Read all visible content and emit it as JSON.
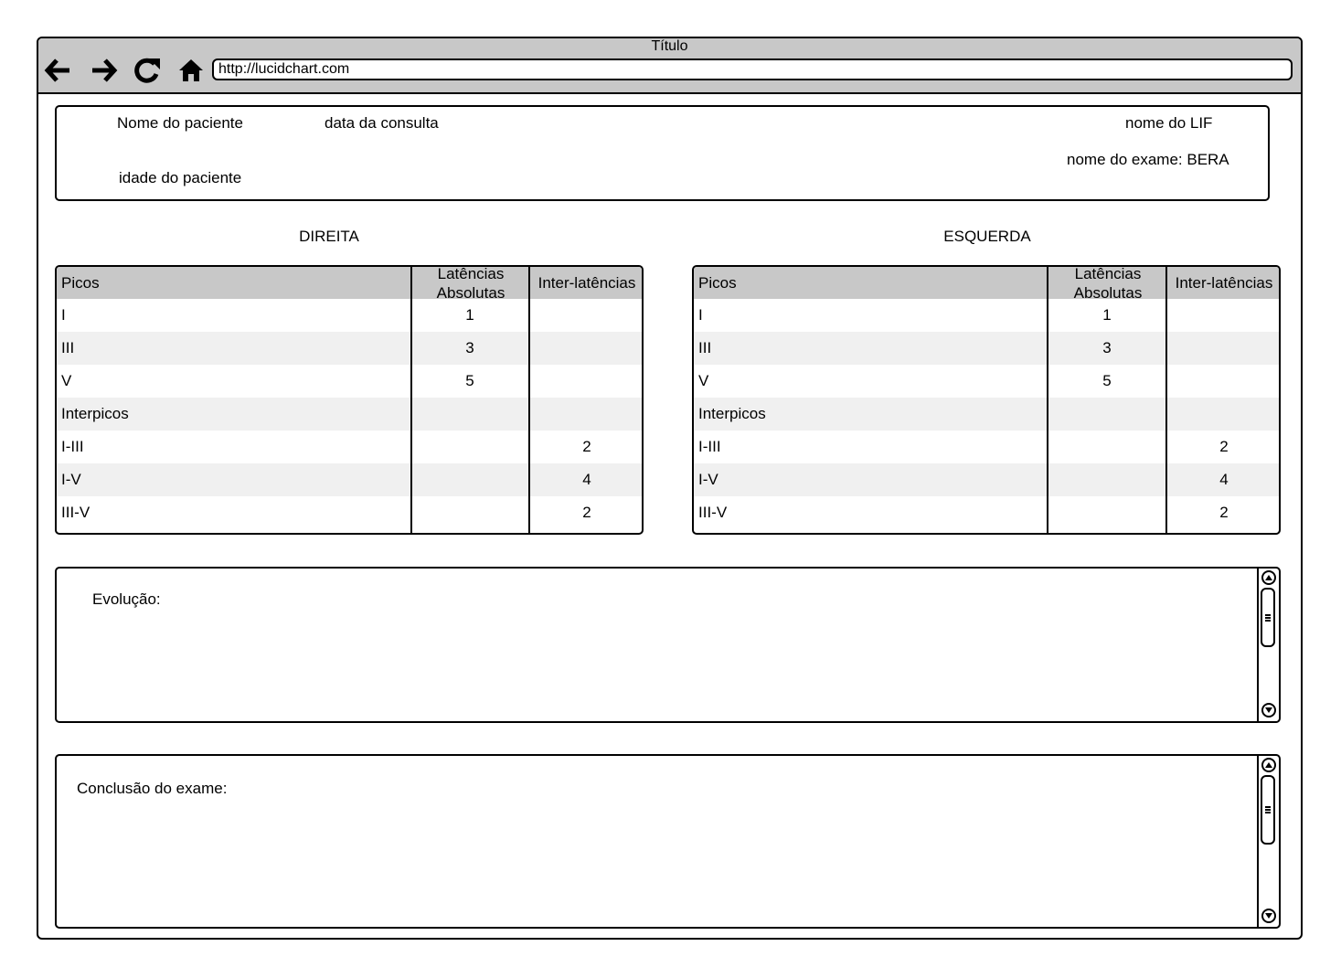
{
  "window": {
    "title": "Título",
    "url": "http://lucidchart.com",
    "nav_icons": [
      "back-arrow-icon",
      "forward-arrow-icon",
      "reload-icon",
      "home-icon"
    ]
  },
  "header": {
    "patient_name": "Nome do paciente",
    "consult_date": "data da consulta",
    "patient_age": "idade do paciente",
    "lif_name": "nome do LIF",
    "exam_name": "nome do exame: BERA"
  },
  "right_table": {
    "title": "DIREITA",
    "columns": [
      "Picos",
      "Latências Absolutas",
      "Inter-latências"
    ],
    "rows": [
      {
        "pico": "I",
        "abs": "1",
        "inter": ""
      },
      {
        "pico": "III",
        "abs": "3",
        "inter": ""
      },
      {
        "pico": "V",
        "abs": "5",
        "inter": ""
      },
      {
        "pico": "Interpicos",
        "abs": "",
        "inter": ""
      },
      {
        "pico": "I-III",
        "abs": "",
        "inter": "2"
      },
      {
        "pico": "I-V",
        "abs": "",
        "inter": "4"
      },
      {
        "pico": "III-V",
        "abs": "",
        "inter": "2"
      }
    ]
  },
  "left_table": {
    "title": "ESQUERDA",
    "columns": [
      "Picos",
      "Latências Absolutas",
      "Inter-latências"
    ],
    "rows": [
      {
        "pico": "I",
        "abs": "1",
        "inter": ""
      },
      {
        "pico": "III",
        "abs": "3",
        "inter": ""
      },
      {
        "pico": "V",
        "abs": "5",
        "inter": ""
      },
      {
        "pico": "Interpicos",
        "abs": "",
        "inter": ""
      },
      {
        "pico": "I-III",
        "abs": "",
        "inter": "2"
      },
      {
        "pico": "I-V",
        "abs": "",
        "inter": "4"
      },
      {
        "pico": "III-V",
        "abs": "",
        "inter": "2"
      }
    ]
  },
  "evolution": {
    "label": "Evolução:"
  },
  "conclusion": {
    "label": "Conclusão do exame:"
  }
}
